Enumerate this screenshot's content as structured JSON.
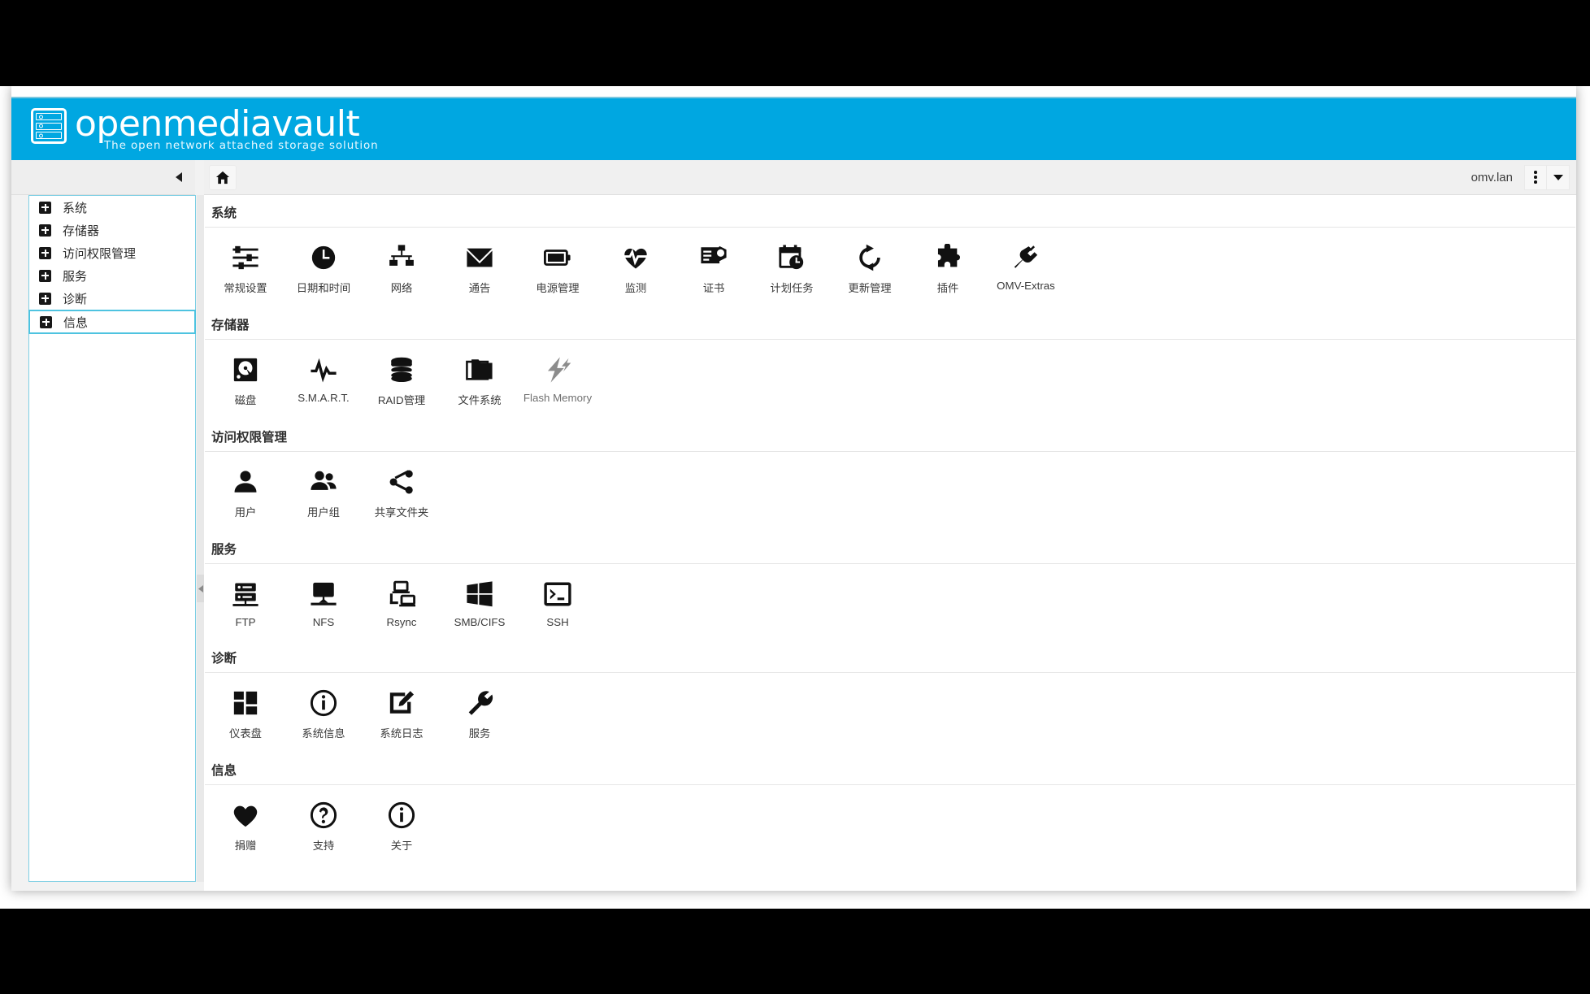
{
  "brand": {
    "wordmark": "openmediavault",
    "tagline": "The open network attached storage solution",
    "logo_icon": "nas-server-icon",
    "banner_color": "#00a7e1"
  },
  "nav": {
    "collapse_icon": "chevron-left-icon",
    "splitter_icon": "chevron-left-icon",
    "items": [
      {
        "label": "系统",
        "icon": "plus-box-icon",
        "selected": false
      },
      {
        "label": "存储器",
        "icon": "plus-box-icon",
        "selected": false
      },
      {
        "label": "访问权限管理",
        "icon": "plus-box-icon",
        "selected": false
      },
      {
        "label": "服务",
        "icon": "plus-box-icon",
        "selected": false
      },
      {
        "label": "诊断",
        "icon": "plus-box-icon",
        "selected": false
      },
      {
        "label": "信息",
        "icon": "plus-box-icon",
        "selected": true
      }
    ]
  },
  "toolbar": {
    "home_icon": "home-icon",
    "host": "omv.lan",
    "menu_icon": "vertical-dots-icon",
    "dropdown_icon": "chevron-down-icon"
  },
  "sections": [
    {
      "title": "系统",
      "tiles": [
        {
          "label": "常规设置",
          "icon": "sliders-icon",
          "disabled": false
        },
        {
          "label": "日期和时间",
          "icon": "clock-icon",
          "disabled": false
        },
        {
          "label": "网络",
          "icon": "network-icon",
          "disabled": false
        },
        {
          "label": "通告",
          "icon": "envelope-icon",
          "disabled": false
        },
        {
          "label": "电源管理",
          "icon": "battery-icon",
          "disabled": false
        },
        {
          "label": "监测",
          "icon": "heart-pulse-icon",
          "disabled": false
        },
        {
          "label": "证书",
          "icon": "certificate-icon",
          "disabled": false
        },
        {
          "label": "计划任务",
          "icon": "calendar-clock-icon",
          "disabled": false
        },
        {
          "label": "更新管理",
          "icon": "refresh-icon",
          "disabled": false
        },
        {
          "label": "插件",
          "icon": "puzzle-icon",
          "disabled": false
        },
        {
          "label": "OMV-Extras",
          "icon": "plug-icon",
          "disabled": false
        }
      ]
    },
    {
      "title": "存储器",
      "tiles": [
        {
          "label": "磁盘",
          "icon": "hard-disk-icon",
          "disabled": false
        },
        {
          "label": "S.M.A.R.T.",
          "icon": "pulse-line-icon",
          "disabled": false
        },
        {
          "label": "RAID管理",
          "icon": "database-icon",
          "disabled": false
        },
        {
          "label": "文件系统",
          "icon": "folder-icon",
          "disabled": false
        },
        {
          "label": "Flash Memory",
          "icon": "lightning-icon",
          "disabled": true
        }
      ]
    },
    {
      "title": "访问权限管理",
      "tiles": [
        {
          "label": "用户",
          "icon": "user-icon",
          "disabled": false
        },
        {
          "label": "用户组",
          "icon": "users-group-icon",
          "disabled": false
        },
        {
          "label": "共享文件夹",
          "icon": "share-nodes-icon",
          "disabled": false
        }
      ]
    },
    {
      "title": "服务",
      "tiles": [
        {
          "label": "FTP",
          "icon": "server-rack-icon",
          "disabled": false
        },
        {
          "label": "NFS",
          "icon": "nfs-share-icon",
          "disabled": false
        },
        {
          "label": "Rsync",
          "icon": "computers-sync-icon",
          "disabled": false
        },
        {
          "label": "SMB/CIFS",
          "icon": "windows-icon",
          "disabled": false
        },
        {
          "label": "SSH",
          "icon": "terminal-icon",
          "disabled": false
        }
      ]
    },
    {
      "title": "诊断",
      "tiles": [
        {
          "label": "仪表盘",
          "icon": "dashboard-icon",
          "disabled": false
        },
        {
          "label": "系统信息",
          "icon": "info-circle-icon",
          "disabled": false
        },
        {
          "label": "系统日志",
          "icon": "log-edit-icon",
          "disabled": false
        },
        {
          "label": "服务",
          "icon": "wrench-icon",
          "disabled": false
        }
      ]
    },
    {
      "title": "信息",
      "tiles": [
        {
          "label": "捐赠",
          "icon": "heart-icon",
          "disabled": false
        },
        {
          "label": "支持",
          "icon": "question-circle-icon",
          "disabled": false
        },
        {
          "label": "关于",
          "icon": "info-circle-icon",
          "disabled": false
        }
      ]
    }
  ]
}
